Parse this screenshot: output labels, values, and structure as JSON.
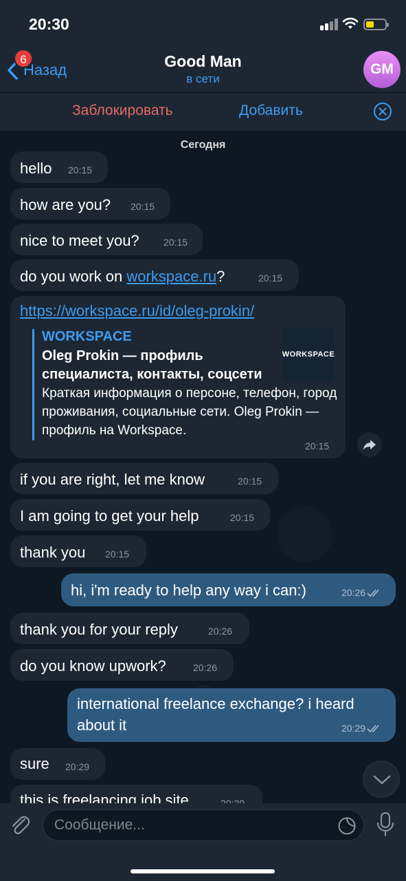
{
  "status": {
    "time": "20:30",
    "battery_color": "#ffd60a"
  },
  "header": {
    "back_label": "Назад",
    "unread_badge": "6",
    "title": "Good Man",
    "status": "в сети",
    "avatar_initials": "GM",
    "accent": "#3e9bf0"
  },
  "actions": {
    "block_label": "Заблокировать",
    "add_label": "Добавить",
    "close_icon": "close-circle-icon"
  },
  "chat": {
    "date_label": "Сегодня",
    "messages": [
      {
        "text": "hello",
        "time": "20:15",
        "dir": "in"
      },
      {
        "text": "how are you?",
        "time": "20:15",
        "dir": "in"
      },
      {
        "text": "nice to meet you?",
        "time": "20:15",
        "dir": "in"
      },
      {
        "text_before": "do you work on ",
        "link": "workspace.ru",
        "text_after": "?",
        "time": "20:15",
        "dir": "in"
      },
      {
        "link": "https://workspace.ru/id/oleg-prokin/",
        "preview": {
          "site": "WORKSPACE",
          "title": "Oleg Prokin — профиль специалиста, контакты, соцсети",
          "description": "Краткая информация о персоне, телефон, город проживания, социальные сети. Oleg Prokin — профиль на Workspace.",
          "thumb_text": "WORKSPACE"
        },
        "time": "20:15",
        "dir": "in"
      },
      {
        "text": "if you are right, let me know",
        "time": "20:15",
        "dir": "in"
      },
      {
        "text": "I am going to get your help",
        "time": "20:15",
        "dir": "in"
      },
      {
        "text": "thank you",
        "time": "20:15",
        "dir": "in"
      },
      {
        "text": "hi, i'm ready to help any way i can:)",
        "time": "20:26",
        "dir": "out",
        "read": true
      },
      {
        "text": "thank you for your reply",
        "time": "20:26",
        "dir": "in"
      },
      {
        "text": "do you know upwork?",
        "time": "20:26",
        "dir": "in"
      },
      {
        "text_line1": "international freelance exchange? i heard",
        "text_line2": "about it",
        "time": "20:29",
        "dir": "out",
        "read": true
      },
      {
        "text": "sure",
        "time": "20:29",
        "dir": "in"
      },
      {
        "text": "this is freelancing job site",
        "time": "20:29",
        "dir": "in"
      }
    ]
  },
  "composer": {
    "placeholder": "Сообщение...",
    "value": ""
  }
}
